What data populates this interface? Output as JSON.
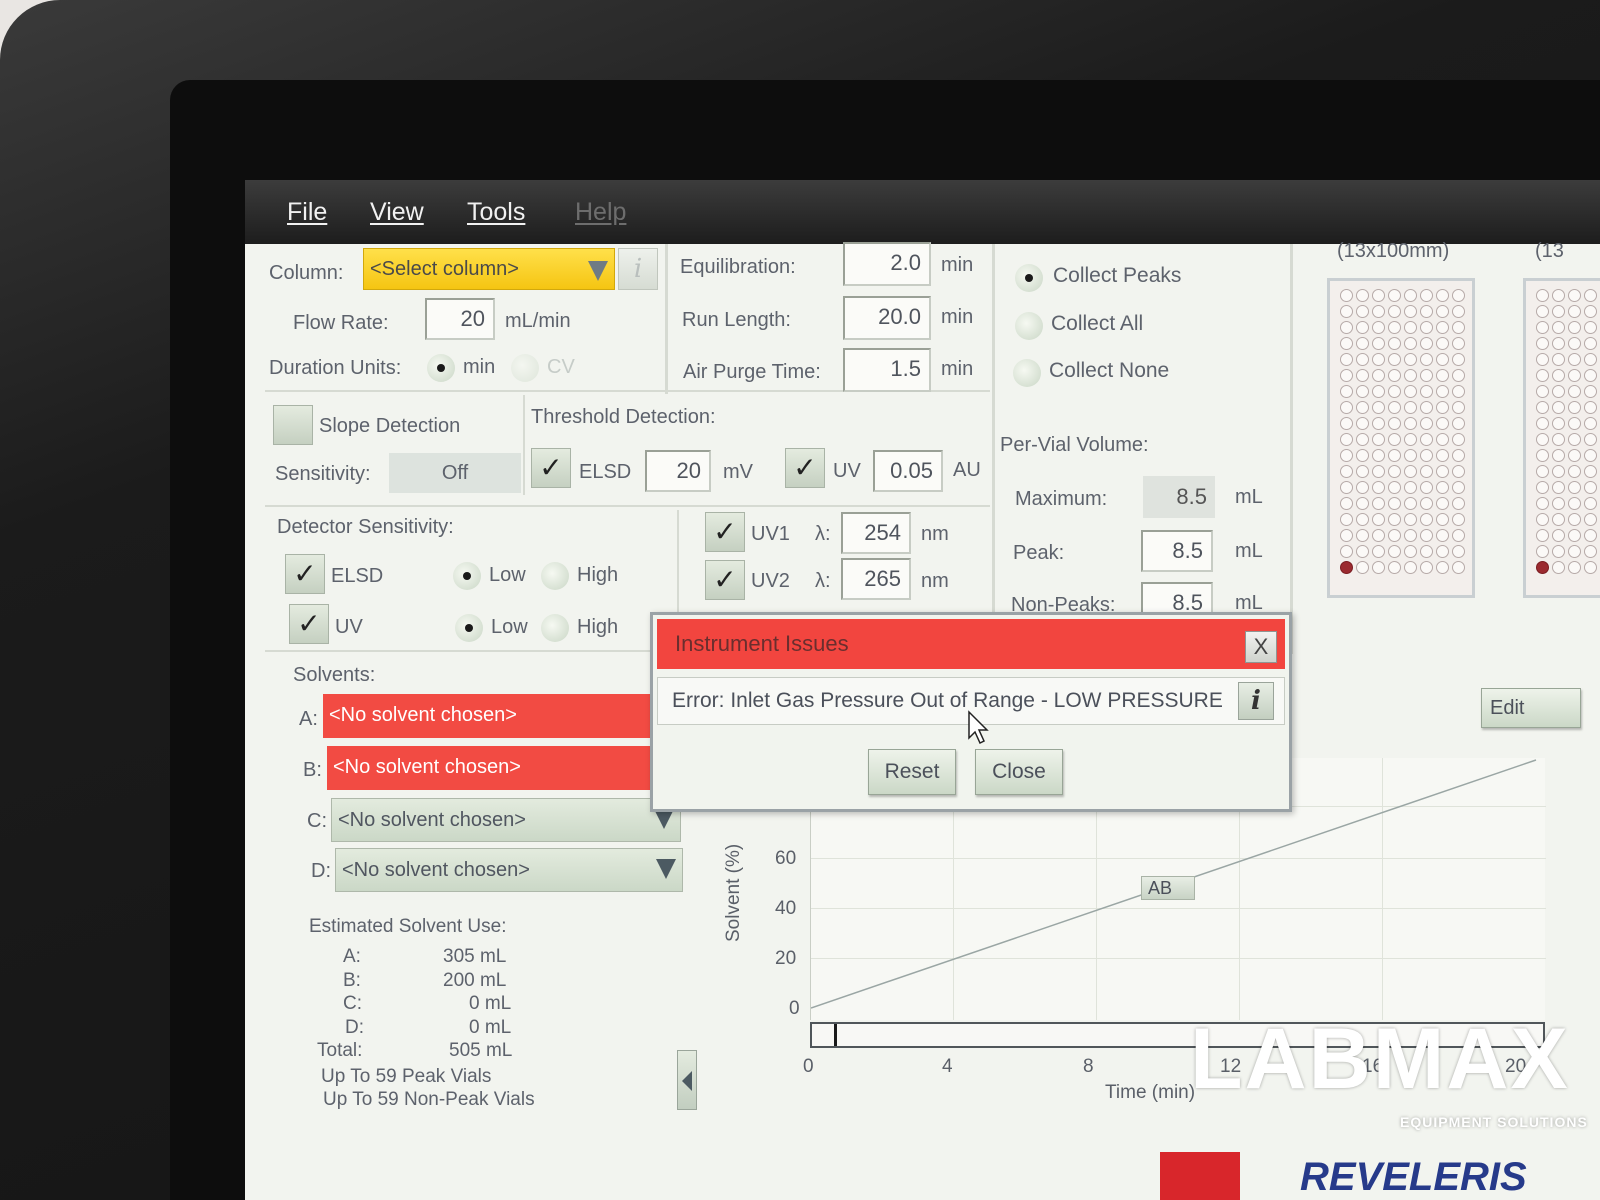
{
  "menu": [
    "File",
    "View",
    "Tools",
    "Help"
  ],
  "column": {
    "label": "Column:",
    "value": "<Select column>",
    "info": "i"
  },
  "flow_rate": {
    "label": "Flow Rate:",
    "value": "20",
    "unit": "mL/min"
  },
  "duration_units": {
    "label": "Duration Units:",
    "opt1": "min",
    "opt2": "CV",
    "selected": "min"
  },
  "equilibration": {
    "label": "Equilibration:",
    "value": "2.0",
    "unit": "min"
  },
  "run_length": {
    "label": "Run Length:",
    "value": "20.0",
    "unit": "min"
  },
  "air_purge": {
    "label": "Air Purge Time:",
    "value": "1.5",
    "unit": "min"
  },
  "collect": {
    "peaks": "Collect Peaks",
    "all": "Collect All",
    "none": "Collect None",
    "selected": "Collect Peaks"
  },
  "rack1": {
    "title": "(13x100mm)"
  },
  "rack2": {
    "title": "(13"
  },
  "slope": {
    "label": "Slope Detection",
    "sensitivity_label": "Sensitivity:",
    "sensitivity_value": "Off"
  },
  "threshold": {
    "label": "Threshold Detection:",
    "elsd": "ELSD",
    "elsd_value": "20",
    "elsd_unit": "mV",
    "uv": "UV",
    "uv_value": "0.05",
    "uv_unit": "AU",
    "check": "✓"
  },
  "per_vial": {
    "label": "Per-Vial Volume:",
    "max_label": "Maximum:",
    "max_value": "8.5",
    "peak_label": "Peak:",
    "peak_value": "8.5",
    "nonpeak_label": "Non-Peaks:",
    "nonpeak_value": "8.5",
    "unit": "mL"
  },
  "detector_sensitivity": {
    "label": "Detector Sensitivity:",
    "elsd": "ELSD",
    "uv": "UV",
    "low": "Low",
    "high": "High"
  },
  "uv_channels": {
    "uv1": "UV1",
    "uv1_lambda": "254",
    "uv2": "UV2",
    "uv2_lambda": "265",
    "lambda": "λ:",
    "unit": "nm"
  },
  "solvents": {
    "label": "Solvents:",
    "a_label": "A:",
    "b_label": "B:",
    "c_label": "C:",
    "d_label": "D:",
    "a": "<No solvent chosen>",
    "b": "<No solvent chosen>",
    "c": "<No solvent chosen>",
    "d": "<No solvent chosen>"
  },
  "estimate": {
    "label": "Estimated Solvent Use:",
    "a_label": "A:",
    "a": "305 mL",
    "b_label": "B:",
    "b": "200 mL",
    "c_label": "C:",
    "c": "0 mL",
    "d_label": "D:",
    "d": "0 mL",
    "total_label": "Total:",
    "total": "505 mL",
    "peak_vials": "Up To 59 Peak Vials",
    "nonpeak_vials": "Up To 59 Non-Peak Vials"
  },
  "dialog": {
    "title": "Instrument Issues",
    "close_x": "X",
    "message": "Error: Inlet Gas Pressure Out of Range - LOW PRESSURE",
    "info": "i",
    "reset": "Reset",
    "close": "Close"
  },
  "edit_button": "Edit",
  "chart": {
    "ylabel": "Solvent (%)",
    "xlabel": "Time (min)",
    "yticks": [
      "60",
      "40",
      "20",
      "0"
    ],
    "xticks": [
      "0",
      "4",
      "8",
      "12",
      "16",
      "20"
    ],
    "tag": "AB"
  },
  "watermark": {
    "brand": "LABMAX",
    "tagline": "EQUIPMENT SOLUTIONS",
    "product": "REVELERIS"
  }
}
